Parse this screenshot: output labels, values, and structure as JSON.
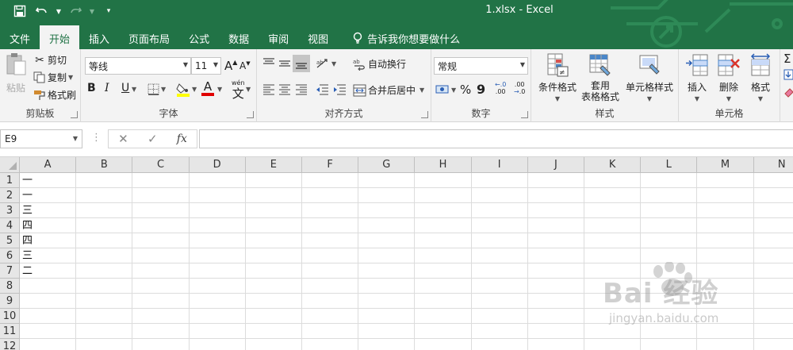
{
  "window": {
    "title": "1.xlsx  -  Excel"
  },
  "tabs": [
    {
      "label": "文件"
    },
    {
      "label": "开始"
    },
    {
      "label": "插入"
    },
    {
      "label": "页面布局"
    },
    {
      "label": "公式"
    },
    {
      "label": "数据"
    },
    {
      "label": "审阅"
    },
    {
      "label": "视图"
    }
  ],
  "tell_me": "告诉我你想要做什么",
  "ribbon": {
    "clipboard": {
      "label": "剪贴板",
      "paste": "粘贴",
      "cut": "剪切",
      "copy": "复制",
      "format_painter": "格式刷"
    },
    "font": {
      "label": "字体",
      "font_name": "等线",
      "font_size": "11",
      "bold": "B",
      "italic": "I",
      "underline": "U",
      "font_color_letter": "A",
      "phonetic_top": "wén",
      "phonetic_char": "文"
    },
    "alignment": {
      "label": "对齐方式",
      "wrap_text": "自动换行",
      "merge_center": "合并后居中"
    },
    "number": {
      "label": "数字",
      "format": "常规",
      "percent": "%",
      "comma": "9",
      "inc_decimal": ".00",
      "dec_decimal": ".0"
    },
    "styles": {
      "label": "样式",
      "conditional": "条件格式",
      "table_style": "套用\n表格格式",
      "cell_style": "单元格样式"
    },
    "cells": {
      "label": "单元格",
      "insert": "插入",
      "delete": "删除",
      "format": "格式"
    }
  },
  "formula_bar": {
    "name_box": "E9",
    "cancel": "✕",
    "enter": "✓",
    "fx": "fx",
    "value": ""
  },
  "sheet": {
    "columns": [
      "A",
      "B",
      "C",
      "D",
      "E",
      "F",
      "G",
      "H",
      "I",
      "J",
      "K",
      "L",
      "M",
      "N"
    ],
    "rows": [
      "1",
      "2",
      "3",
      "4",
      "5",
      "6",
      "7",
      "8",
      "9",
      "10",
      "11",
      "12"
    ],
    "column_a_values": [
      "一",
      "一",
      "三",
      "四",
      "四",
      "三",
      "二",
      "",
      "",
      "",
      "",
      ""
    ]
  },
  "watermark": {
    "brand": "Bai 经验",
    "url": "jingyan.baidu.com"
  },
  "colors": {
    "excel_green": "#217346",
    "ribbon_bg": "#f3f3f3",
    "header_bg": "#e6e6e6",
    "grid_line": "#dcdcdc"
  }
}
